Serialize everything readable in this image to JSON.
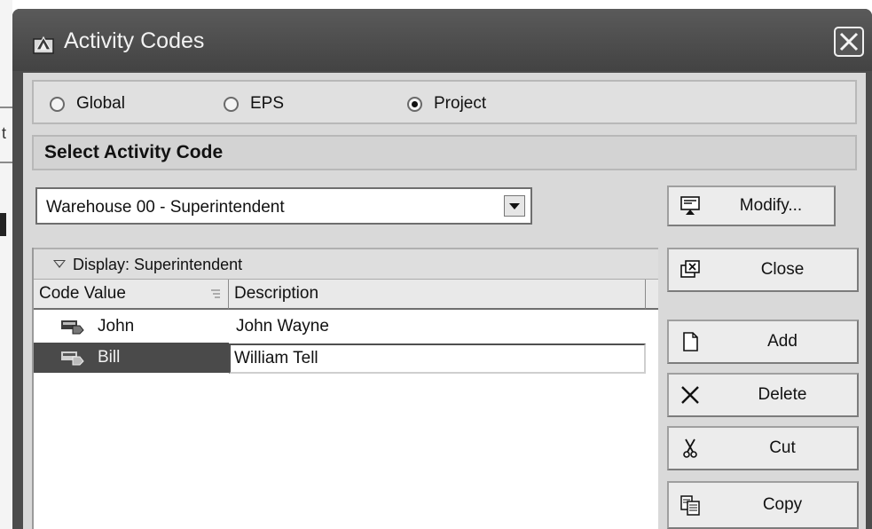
{
  "window": {
    "title": "Activity Codes"
  },
  "scope": {
    "options": [
      {
        "label": "Global",
        "selected": false
      },
      {
        "label": "EPS",
        "selected": false
      },
      {
        "label": "Project",
        "selected": true
      }
    ]
  },
  "select_section": {
    "heading": "Select Activity Code",
    "selected_code": "Warehouse 00 - Superintendent"
  },
  "buttons": {
    "modify": {
      "label": "Modify...",
      "icon": "modify-icon"
    },
    "close": {
      "label": "Close",
      "icon": "close-window-icon"
    },
    "add": {
      "label": "Add",
      "icon": "new-document-icon"
    },
    "delete": {
      "label": "Delete",
      "icon": "delete-x-icon"
    },
    "cut": {
      "label": "Cut",
      "icon": "scissors-icon"
    },
    "copy": {
      "label": "Copy",
      "icon": "copy-icon"
    }
  },
  "grid": {
    "display_label": "Display: Superintendent",
    "columns": [
      "Code Value",
      "Description"
    ],
    "rows": [
      {
        "code": "John",
        "description": "John Wayne",
        "selected": false
      },
      {
        "code": "Bill",
        "description": "William Tell",
        "selected": true
      }
    ]
  },
  "background": {
    "partial_char": "t"
  }
}
